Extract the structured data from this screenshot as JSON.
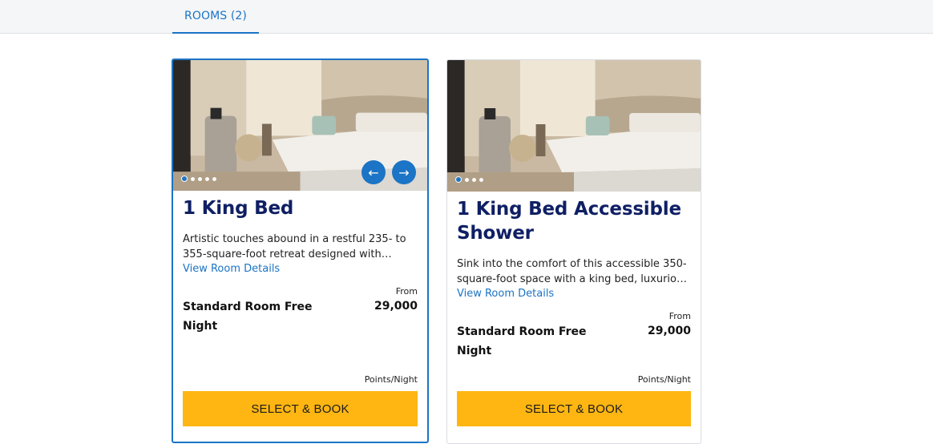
{
  "tabs": {
    "rooms": "ROOMS (2)"
  },
  "rooms": [
    {
      "title": "1 King Bed",
      "description": "Artistic touches abound in a restful 235- to 355-square-foot retreat designed with natural materials and soft tones.",
      "view_details": "View Room Details",
      "from_label": "From",
      "points": "29,000",
      "rate_name": "Standard Room Free Night",
      "per_label": "Points/Night",
      "book_label": "SELECT & BOOK",
      "photo_count": 5,
      "selected": true
    },
    {
      "title": "1 King Bed Accessible Shower",
      "description": "Sink into the comfort of this accessible 350-square-foot space with a king bed, luxurious linens and a roll-in shower.",
      "view_details": "View Room Details",
      "from_label": "From",
      "points": "29,000",
      "rate_name": "Standard Room Free Night",
      "per_label": "Points/Night",
      "book_label": "SELECT & BOOK",
      "photo_count": 4,
      "selected": false
    }
  ],
  "icons": {
    "prev": "arrow-left-icon",
    "next": "arrow-right-icon"
  },
  "colors": {
    "accent": "#1b74c5",
    "title": "#0f1f64",
    "book_button": "#ffb612"
  }
}
